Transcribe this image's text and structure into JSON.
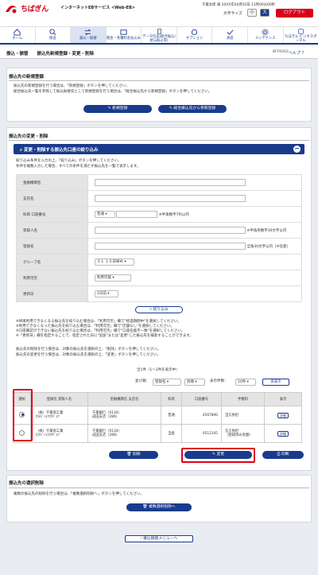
{
  "header": {
    "bank_name": "ちばぎん",
    "service_name": "インターネットEBサービス <Web-EB>",
    "user_line": "千葉太郎 様 20XX年04月02日 11時00分00秒",
    "user_name": "千葉太郎",
    "font_size_label": "文字サイズ",
    "font_small": "小",
    "font_large": "大",
    "logout": "ログアウト"
  },
  "nav": [
    {
      "label": "ホーム",
      "icon": "home-icon"
    },
    {
      "label": "照会",
      "icon": "search-icon"
    },
    {
      "label": "振込・振替",
      "icon": "transfer-icon",
      "active": true
    },
    {
      "label": "税金・各種料金払込み",
      "icon": "tax-icon"
    },
    {
      "label": "データ伝送(総合振込/給与振込等)",
      "icon": "data-icon"
    },
    {
      "label": "オプション",
      "icon": "option-icon"
    },
    {
      "label": "承認",
      "icon": "approve-icon"
    },
    {
      "label": "メンテナンス",
      "icon": "gear-icon"
    },
    {
      "label": "ちばぎん ビジネスポータル",
      "icon": "portal-icon"
    }
  ],
  "breadcrumb": {
    "title": "振込・振替　　振込先新規登録・変更・削除",
    "screen_id": "BFFK002",
    "help": "ヘルプ"
  },
  "new_section": {
    "title": "振込先の新規登録",
    "line1": "振込先の新規登録を行う場合は、「新規登録」ボタンを押してください。",
    "line2": "総合振込先一覧を参照して振込振替先として新規登録を行う場合は、「総合振込先から新規登録」ボタンを押してください。",
    "btn_new": "新規登録",
    "btn_ref": "総合振込先から参照登録"
  },
  "change_section": {
    "title": "振込先の変更・削除",
    "accordion": "変更・削除する振込先口座の絞り込み",
    "intro1": "絞り込み条件を入力の上、「絞り込み」ボタンを押してください。",
    "intro2": "条件を複数入力した場合、すべての条件を満たす振込先を一覧で表示します。"
  },
  "filter": {
    "bank_label": "金融機関名",
    "branch_label": "支店名",
    "account_label": "科目 口座番号",
    "account_type": "普通",
    "account_hint": "※半角数字7桁以内",
    "payee_label": "受取人名",
    "payee_hint": "※半角英数字30文字以内",
    "reg_label": "登録名",
    "reg_hint": "全角30文字以内［※任意］",
    "group_label": "グループ名",
    "group_value": "０１ １０日締め",
    "usage_label": "利用可否",
    "usage_value": "利用可能",
    "sort_label": "更新日",
    "sort_value": "1日前",
    "btn_filter": "絞り込み"
  },
  "notes": [
    "※将来利用できなくなる振込先を絞り込む場合は、「利用可否」欄で\"経過期間中\"を選択してください。",
    "※利用できなくなった振込先を絞り込む場合は、「利用可否」欄で\"店舗なし\"を選択してください。",
    "※口座確認ができない振込先を絞り込む場合は、「利用可否」欄で\"口座名義不一致\"を選択してください。",
    "※「更新日」欄を指定することで、指定された日に\"追加\"または\"変更\"した振込先を検索することができます。"
  ],
  "list_intro": [
    "振込先の削除を行う場合は、対象の振込先を選択の上、「削除」ボタンを押してください。",
    "振込先の変更を行う場合は、対象の振込先を選択の上、「変更」ボタンを押してください。"
  ],
  "list_meta": {
    "count": "全1件（1～1件を表示中）",
    "sort_order_label": "並び順：",
    "sort_order_value": "登録名",
    "direction_value": "昇順",
    "per_page_label": "表示件数：",
    "per_page_value": "10件",
    "redisplay": "再表示"
  },
  "columns": [
    "選択",
    "登録名 受取人名",
    "金融機関名 支店名",
    "科目",
    "口座番号",
    "手数料",
    "表示"
  ],
  "rows": [
    {
      "reg": "（株）千葉商工業",
      "payee": "ｶ)ﾁﾊﾞｼｮｳｺｳｷﾞｮｳ",
      "bank": "千葉銀行（0134）",
      "branch": "成田支店（286）",
      "type": "普通",
      "account": "4567890",
      "fee": "当方負担",
      "fee2": "",
      "detail": "詳細",
      "selected": true
    },
    {
      "reg": "（株）千葉商工業",
      "payee": "ｶ)ﾁﾊﾞｼｮｳｺｳｷﾞｮｳ",
      "bank": "千葉銀行（0134）",
      "branch": "成田支店（286）",
      "type": "当座",
      "account": "0512345",
      "fee": "先方負担",
      "fee2": "（登録済み金額）",
      "detail": "詳細",
      "selected": false
    }
  ],
  "actions": {
    "delete": "削除",
    "change": "変更",
    "print": "印刷"
  },
  "bulk_section": {
    "title": "振込先の選択削除",
    "line": "複数の振込先の削除を行う場合は、「複数選択削除へ」ボタンを押してください。",
    "btn": "複数選択削除へ"
  },
  "footer": {
    "back": "振込振替メニューへ"
  },
  "colors": {
    "brand": "#d7001b",
    "navy": "#1a3b8c",
    "highlight": "#e0001a"
  }
}
